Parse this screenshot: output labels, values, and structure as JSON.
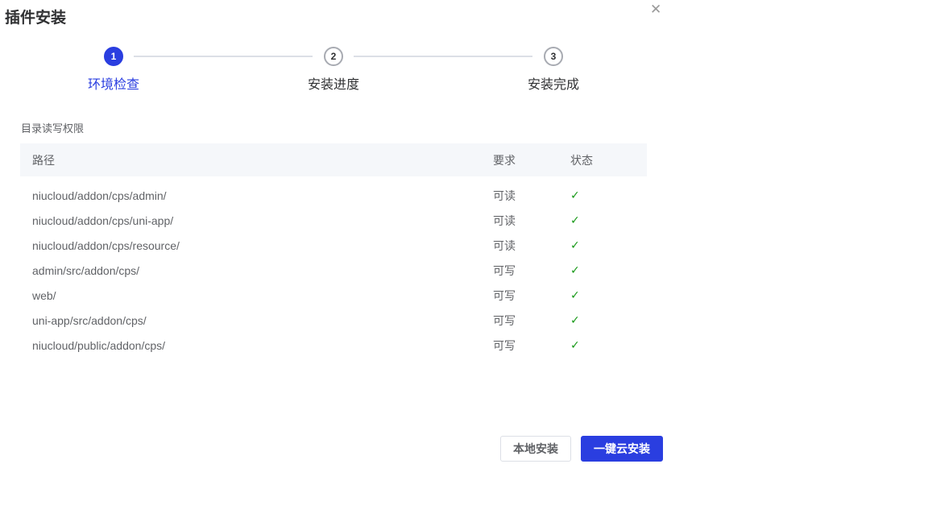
{
  "dialog": {
    "title": "插件安装",
    "close_icon": "close-icon"
  },
  "steps": [
    {
      "number": "1",
      "label": "环境检查"
    },
    {
      "number": "2",
      "label": "安装进度"
    },
    {
      "number": "3",
      "label": "安装完成"
    }
  ],
  "active_step": 1,
  "section_title": "目录读写权限",
  "table": {
    "headers": [
      "路径",
      "要求",
      "状态"
    ],
    "rows": [
      {
        "path": "niucloud/addon/cps/admin/",
        "req": "可读",
        "status": "✓"
      },
      {
        "path": "niucloud/addon/cps/uni-app/",
        "req": "可读",
        "status": "✓"
      },
      {
        "path": "niucloud/addon/cps/resource/",
        "req": "可读",
        "status": "✓"
      },
      {
        "path": "admin/src/addon/cps/",
        "req": "可写",
        "status": "✓"
      },
      {
        "path": "web/",
        "req": "可写",
        "status": "✓"
      },
      {
        "path": "uni-app/src/addon/cps/",
        "req": "可写",
        "status": "✓"
      },
      {
        "path": "niucloud/public/addon/cps/",
        "req": "可写",
        "status": "✓"
      }
    ]
  },
  "buttons": {
    "local": "本地安装",
    "cloud": "一键云安装"
  },
  "colors": {
    "primary": "#2a3ee0",
    "success": "#1a9a1a"
  }
}
